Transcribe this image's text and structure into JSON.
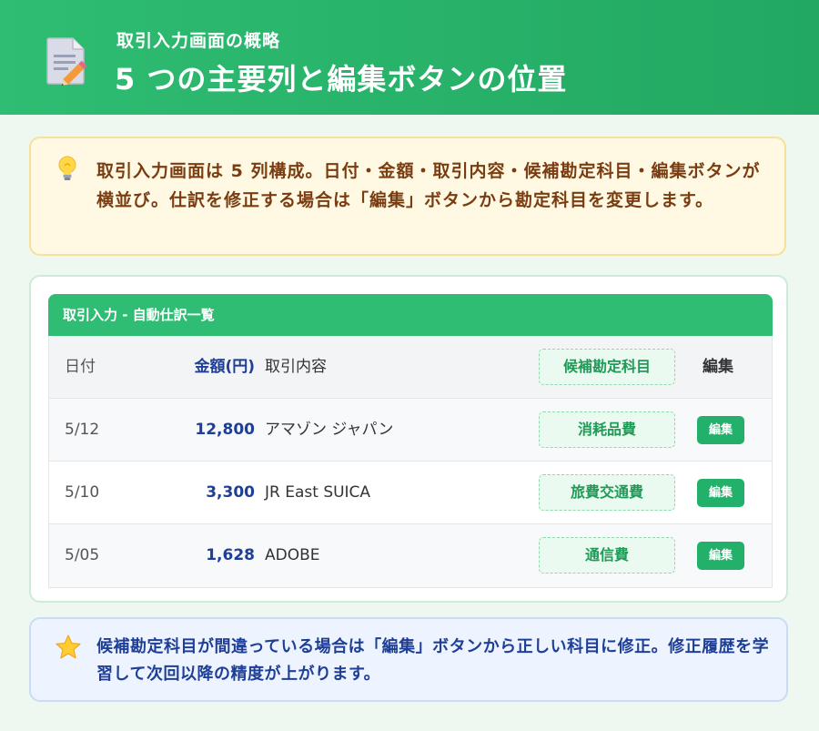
{
  "header": {
    "subtitle": "取引入力画面の概略",
    "title": "5 つの主要列と編集ボタンの位置",
    "icon": "document-pencil-icon"
  },
  "tip": {
    "icon": "lightbulb-icon",
    "text": "取引入力画面は 5 列構成。日付・金額・取引内容・候補勘定科目・編集ボタンが横並び。仕訳を修正する場合は「編集」ボタンから勘定科目を変更します。"
  },
  "table": {
    "title": "取引入力 - 自動仕訳一覧",
    "columns": {
      "date": "日付",
      "amount": "金額(円)",
      "description": "取引内容",
      "account": "候補勘定科目",
      "edit": "編集"
    },
    "rows": [
      {
        "date": "5/12",
        "amount": "12,800",
        "description": "アマゾン ジャパン",
        "account": "消耗品費",
        "edit_label": "編集"
      },
      {
        "date": "5/10",
        "amount": "3,300",
        "description": "JR East SUICA",
        "account": "旅費交通費",
        "edit_label": "編集"
      },
      {
        "date": "5/05",
        "amount": "1,628",
        "description": "ADOBE",
        "account": "通信費",
        "edit_label": "編集"
      }
    ]
  },
  "note": {
    "icon": "star-icon",
    "text": "候補勘定科目が間違っている場合は「編集」ボタンから正しい科目に修正。修正履歴を学習して次回以降の精度が上がります。"
  },
  "colors": {
    "brand_green": "#2ebd72",
    "amount_blue": "#1f3f96",
    "tip_brown": "#7a3d12"
  }
}
